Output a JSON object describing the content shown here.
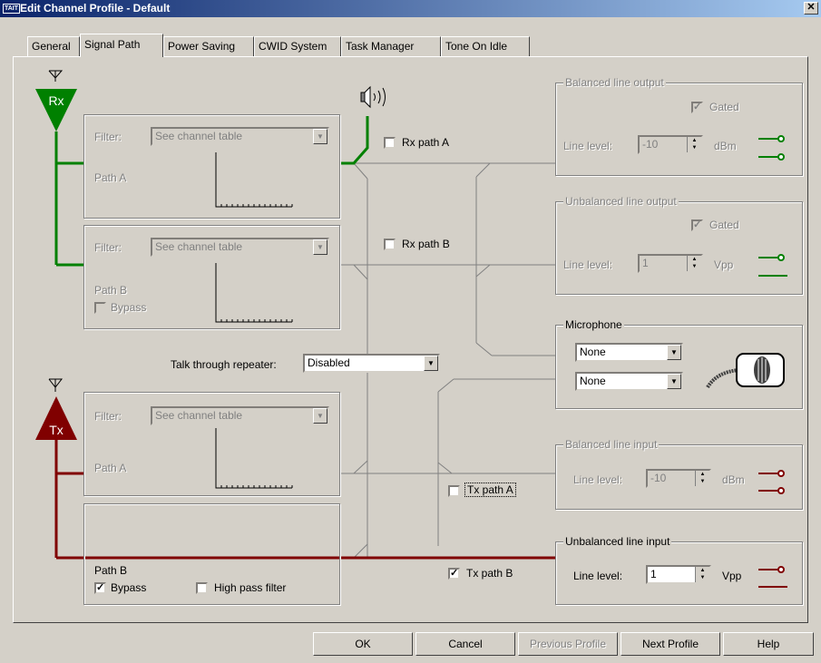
{
  "window": {
    "title": "Edit Channel Profile - Default",
    "icon_text": "TAIT"
  },
  "tabs": [
    {
      "label": "General"
    },
    {
      "label": "Signal Path"
    },
    {
      "label": "Power Saving"
    },
    {
      "label": "CWID System"
    },
    {
      "label": "Task Manager"
    },
    {
      "label": "Tone On Idle"
    }
  ],
  "rx": {
    "antenna_label": "Rx",
    "pathA": {
      "filter_label": "Filter:",
      "filter_value": "See channel table",
      "path_label": "Path A"
    },
    "pathB": {
      "filter_label": "Filter:",
      "filter_value": "See channel table",
      "path_label": "Path B",
      "bypass_label": "Bypass"
    },
    "rx_path_a": "Rx path A",
    "rx_path_b": "Rx path B"
  },
  "talk_through": {
    "label": "Talk through repeater:",
    "value": "Disabled"
  },
  "tx": {
    "antenna_label": "Tx",
    "pathA": {
      "filter_label": "Filter:",
      "filter_value": "See channel table",
      "path_label": "Path A"
    },
    "pathB": {
      "path_label": "Path B",
      "bypass_label": "Bypass",
      "hpf_label": "High pass filter"
    },
    "tx_path_a": "Tx path A",
    "tx_path_b": "Tx path B"
  },
  "balanced_output": {
    "title": "Balanced line output",
    "gated_label": "Gated",
    "level_label": "Line level:",
    "level_value": "-10",
    "unit": "dBm"
  },
  "unbalanced_output": {
    "title": "Unbalanced line output",
    "gated_label": "Gated",
    "level_label": "Line level:",
    "level_value": "1",
    "unit": "Vpp"
  },
  "microphone": {
    "title": "Microphone",
    "select1": "None",
    "select2": "None"
  },
  "balanced_input": {
    "title": "Balanced line input",
    "level_label": "Line level:",
    "level_value": "-10",
    "unit": "dBm"
  },
  "unbalanced_input": {
    "title": "Unbalanced line input",
    "level_label": "Line level:",
    "level_value": "1",
    "unit": "Vpp"
  },
  "buttons": {
    "ok": "OK",
    "cancel": "Cancel",
    "previous": "Previous Profile",
    "next": "Next Profile",
    "help": "Help"
  },
  "colors": {
    "rx": "#008000",
    "tx": "#800000",
    "wire": "#808080"
  }
}
